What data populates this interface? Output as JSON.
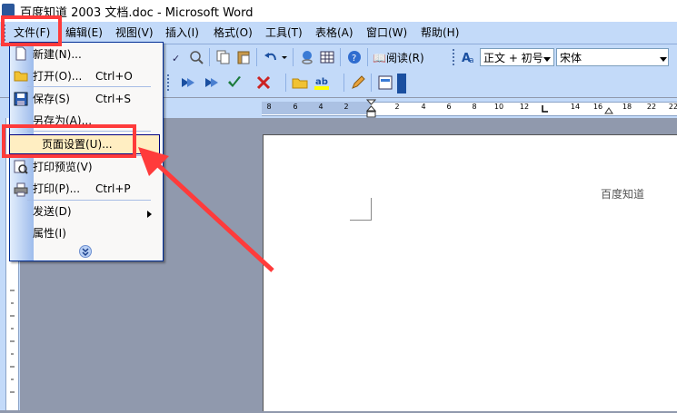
{
  "window": {
    "title": "百度知道 2003 文档.doc - Microsoft Word"
  },
  "menubar": {
    "items": [
      "文件(F)",
      "编辑(E)",
      "视图(V)",
      "插入(I)",
      "格式(O)",
      "工具(T)",
      "表格(A)",
      "窗口(W)",
      "帮助(H)"
    ]
  },
  "toolbar": {
    "read_label": "阅读(R)",
    "style_value": "正文 + 初号",
    "font_value": "宋体"
  },
  "ruler": {
    "ticks": [
      "8",
      "6",
      "4",
      "2",
      "2",
      "4",
      "6",
      "8",
      "10",
      "12",
      "14",
      "16",
      "18",
      "22",
      "22"
    ]
  },
  "file_menu": {
    "items": [
      {
        "label": "新建(N)...",
        "shortcut": ""
      },
      {
        "label": "打开(O)...",
        "shortcut": "Ctrl+O"
      },
      {
        "label": "保存(S)",
        "shortcut": "Ctrl+S"
      },
      {
        "label": "另存为(A)...",
        "shortcut": ""
      },
      {
        "label": "页面设置(U)...",
        "shortcut": ""
      },
      {
        "label": "打印预览(V)",
        "shortcut": ""
      },
      {
        "label": "打印(P)...",
        "shortcut": "Ctrl+P"
      },
      {
        "label": "发送(D)",
        "shortcut": ""
      },
      {
        "label": "属性(I)",
        "shortcut": ""
      }
    ],
    "expand_icon": "double-chevron-down-icon"
  },
  "document": {
    "watermark_text": "百度知道"
  },
  "annotation": {
    "color": "#ff3b3b"
  }
}
